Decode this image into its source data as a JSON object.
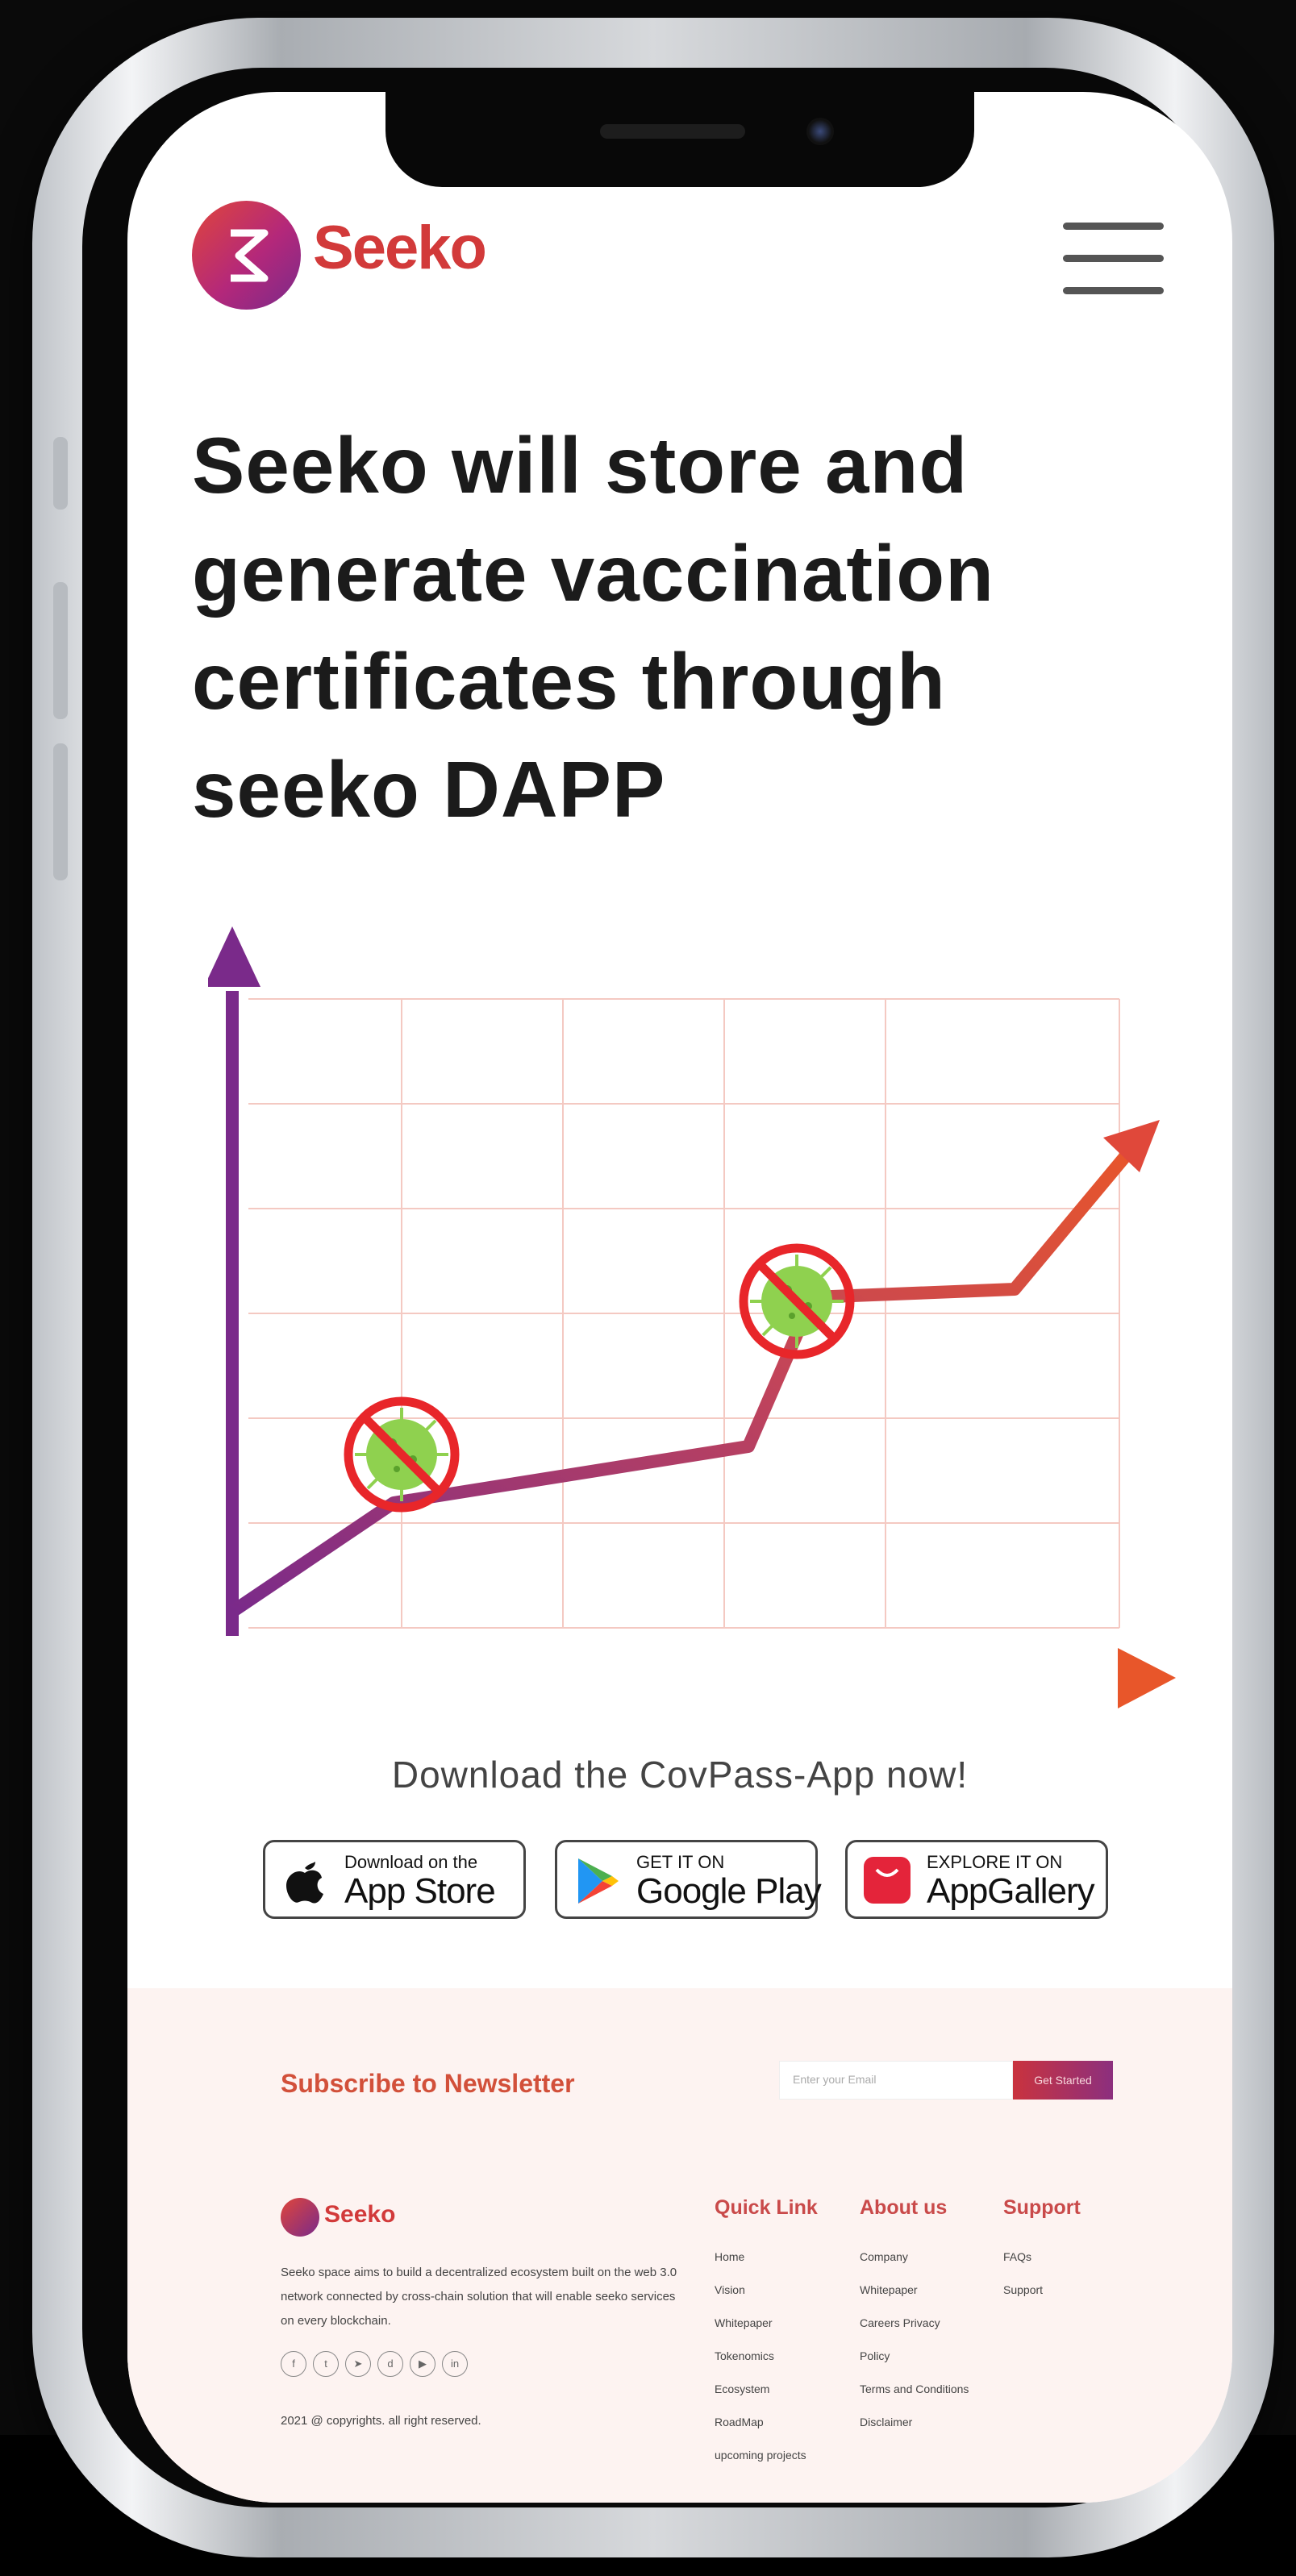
{
  "brand": {
    "name": "Seeko"
  },
  "hero": {
    "line1": "Seeko will store and",
    "line2": "generate vaccination",
    "line3": "certificates through",
    "line4": "seeko DAPP"
  },
  "download": {
    "title": "Download the CovPass-App now!",
    "app_store": {
      "small": "Download on the",
      "big": "App Store"
    },
    "google_play": {
      "small": "GET IT ON",
      "big": "Google Play"
    },
    "app_gallery": {
      "small": "EXPLORE IT ON",
      "big": "AppGallery"
    }
  },
  "newsletter": {
    "title": "Subscribe to Newsletter",
    "placeholder": "Enter your Email",
    "button": "Get Started"
  },
  "footer": {
    "description": "Seeko space aims to build a decentralized ecosystem built on the web 3.0 network connected by cross-chain solution that will enable seeko services on every blockchain.",
    "copyright": "2021 @ copyrights. all right reserved.",
    "quick_link": {
      "title": "Quick Link",
      "items": [
        "Home",
        "Vision",
        "Whitepaper",
        "Tokenomics",
        "Ecosystem",
        "RoadMap",
        "upcoming projects"
      ]
    },
    "about_us": {
      "title": "About us",
      "items": [
        "Company",
        "Whitepaper",
        "Careers Privacy",
        "Policy",
        "Terms and Conditions",
        "Disclaimer"
      ]
    },
    "support": {
      "title": "Support",
      "items": [
        "FAQs",
        "Support"
      ]
    }
  },
  "colors": {
    "brand_red": "#d23a3a",
    "brand_purple": "#7a2a8a",
    "virus_green": "#8fd14f",
    "ban_red": "#e8262a"
  }
}
